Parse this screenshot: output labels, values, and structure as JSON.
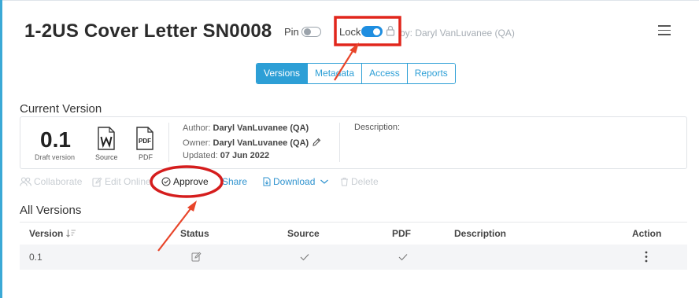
{
  "header": {
    "title": "1-2US Cover Letter SN0008",
    "pin_label": "Pin",
    "lock_label": "Lock",
    "lock_by": "by: Daryl VanLuvanee (QA)"
  },
  "tabs": [
    {
      "label": "Versions",
      "active": true
    },
    {
      "label": "Metadata",
      "active": false
    },
    {
      "label": "Access",
      "active": false
    },
    {
      "label": "Reports",
      "active": false
    }
  ],
  "current_version": {
    "heading": "Current Version",
    "version": "0.1",
    "version_sub": "Draft version",
    "source_label": "Source",
    "pdf_label": "PDF",
    "author_key": "Author:",
    "author": "Daryl VanLuvanee (QA)",
    "owner_key": "Owner:",
    "owner": "Daryl VanLuvanee (QA)",
    "updated_key": "Updated:",
    "updated": "07 Jun 2022",
    "description_key": "Description:"
  },
  "actions": {
    "collaborate": "Collaborate",
    "edit_online": "Edit Online",
    "approve": "Approve",
    "share": "Share",
    "download": "Download",
    "delete": "Delete"
  },
  "all_versions": {
    "heading": "All Versions",
    "columns": [
      "Version",
      "Status",
      "Source",
      "PDF",
      "Description",
      "Action"
    ],
    "rows": [
      {
        "version": "0.1",
        "description": ""
      }
    ]
  },
  "colors": {
    "accent": "#2d9fd6",
    "toggle_on": "#1f8ee0",
    "annotation_red": "#e1261c"
  }
}
